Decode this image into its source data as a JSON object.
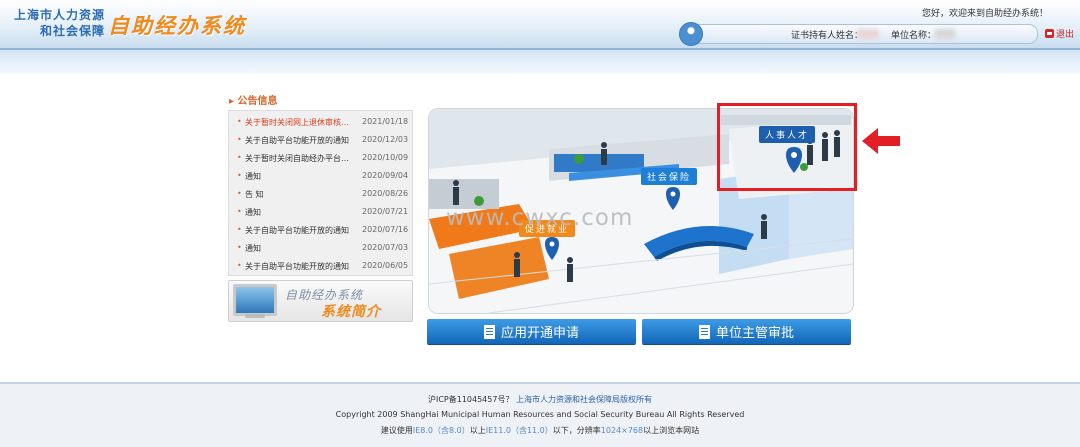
{
  "header": {
    "logo_line1": "上海市人力资源",
    "logo_line2": "和社会保障",
    "logo_main": "自助经办系统",
    "greeting": "您好，欢迎来到自助经办系统！",
    "user_name_label": "证书持有人姓名：",
    "unit_label": "单位名称：",
    "logout_label": "退出"
  },
  "notices": {
    "title": "公告信息",
    "items": [
      {
        "text": "关于暂时关闭网上退休审核…",
        "date": "2021/01/18"
      },
      {
        "text": "关于自助平台功能开放的通知",
        "date": "2020/12/03"
      },
      {
        "text": "关于暂时关闭自助经办平台…",
        "date": "2020/10/09"
      },
      {
        "text": "通知",
        "date": "2020/09/04"
      },
      {
        "text": "告 知",
        "date": "2020/08/26"
      },
      {
        "text": "通知",
        "date": "2020/07/21"
      },
      {
        "text": "关于自助平台功能开放的通知",
        "date": "2020/07/16"
      },
      {
        "text": "通知",
        "date": "2020/07/03"
      },
      {
        "text": "关于自助平台功能开放的通知",
        "date": "2020/06/05"
      }
    ]
  },
  "intro": {
    "line1": "自助经办系统",
    "line2": "系统简介"
  },
  "scene": {
    "label_hr": "人事人才",
    "label_social": "社会保险",
    "label_employment": "促进就业",
    "watermark": "www.cwxc.com"
  },
  "buttons": {
    "apply": "应用开通申请",
    "approve": "单位主管审批"
  },
  "footer": {
    "icp": "沪ICP备11045457号？",
    "owner": "上海市人力资源和社会保障局版权所有",
    "copyright": "Copyright 2009 ShangHai Municipal Human Resources and Social Security Bureau All Rights Reserved",
    "req_prefix": "建议使用",
    "req_ie8": "IE8.0（含8.0）",
    "req_mid": "以上",
    "req_ie11": "IE11.0（含11.0）",
    "req_mid2": "以下，分辨率",
    "req_res": "1024×768",
    "req_suffix": "以上浏览本网站"
  },
  "colors": {
    "accent_orange": "#f08a1c",
    "brand_blue": "#2b6cb4",
    "highlight_red": "#e31e24",
    "button_blue": "#1e7fd6"
  }
}
